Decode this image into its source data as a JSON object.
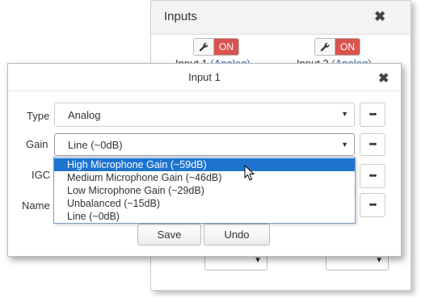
{
  "background_panel": {
    "title": "Inputs",
    "toggle_label": "ON",
    "input1": {
      "label": "Input 1",
      "link": "(Analog)"
    },
    "input2": {
      "label": "Input 2",
      "link": "(Analog)"
    }
  },
  "dialog": {
    "title": "Input 1",
    "type": {
      "label": "Type",
      "value": "Analog"
    },
    "gain": {
      "label": "Gain",
      "value": "Line (~0dB)",
      "options": [
        "High Microphone Gain (~59dB)",
        "Medium Microphone Gain (~46dB)",
        "Low Microphone Gain (~29dB)",
        "Unbalanced (~15dB)",
        "Line (~0dB)"
      ],
      "highlighted_option": "High Microphone Gain (~59dB)"
    },
    "igc": {
      "label": "IGC"
    },
    "name": {
      "label": "Name"
    },
    "more_label": "•••",
    "save_label": "Save",
    "undo_label": "Undo"
  },
  "icons": {
    "close": "close-icon",
    "wrench": "wrench-icon",
    "dropdown": "caret-down-icon",
    "cursor": "mouse-pointer-icon"
  },
  "colors": {
    "toggle_on": "#d9534f",
    "highlight": "#1e73d0",
    "link": "#2a6fb0"
  }
}
